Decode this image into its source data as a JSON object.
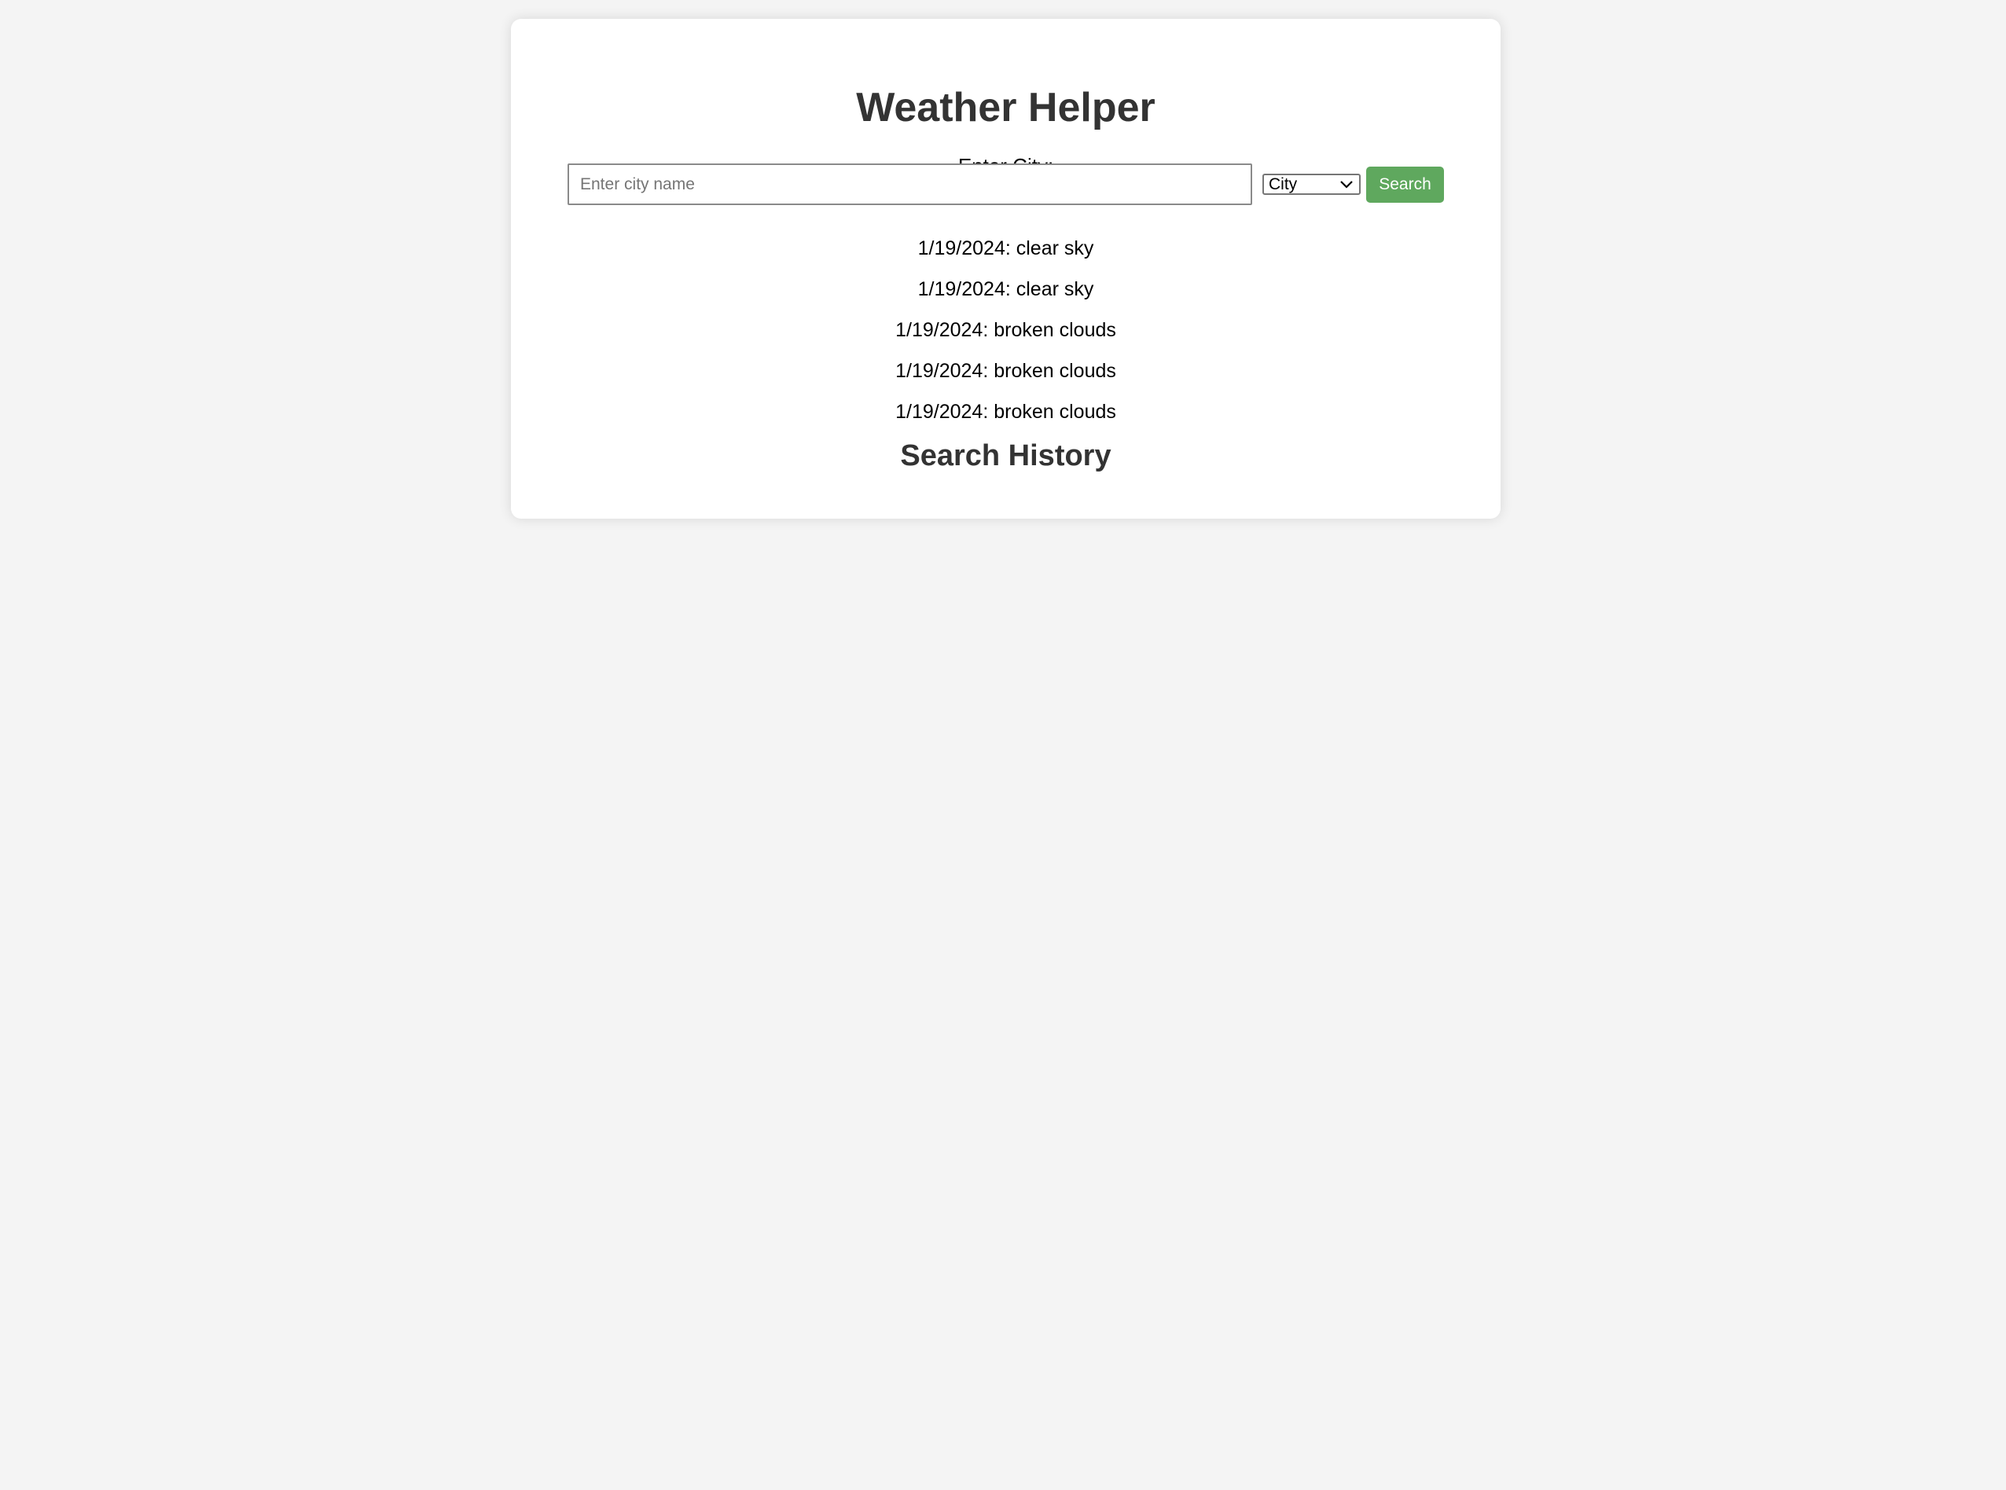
{
  "app": {
    "title": "Weather Helper"
  },
  "search": {
    "label": "Enter City:",
    "placeholder": "Enter city name",
    "value": "",
    "type_selected": "City",
    "button_label": "Search"
  },
  "forecast": [
    {
      "date": "1/19/2024",
      "description": "clear sky",
      "text": "1/19/2024: clear sky"
    },
    {
      "date": "1/19/2024",
      "description": "clear sky",
      "text": "1/19/2024: clear sky"
    },
    {
      "date": "1/19/2024",
      "description": "broken clouds",
      "text": "1/19/2024: broken clouds"
    },
    {
      "date": "1/19/2024",
      "description": "broken clouds",
      "text": "1/19/2024: broken clouds"
    },
    {
      "date": "1/19/2024",
      "description": "broken clouds",
      "text": "1/19/2024: broken clouds"
    }
  ],
  "history": {
    "title": "Search History",
    "items": []
  },
  "colors": {
    "page_background": "#f4f4f4",
    "card_background": "#ffffff",
    "heading_text": "#333333",
    "button_background": "#5fa85e",
    "button_text": "#ffffff"
  },
  "icons": {
    "select_arrow": "chevron-down-icon"
  }
}
